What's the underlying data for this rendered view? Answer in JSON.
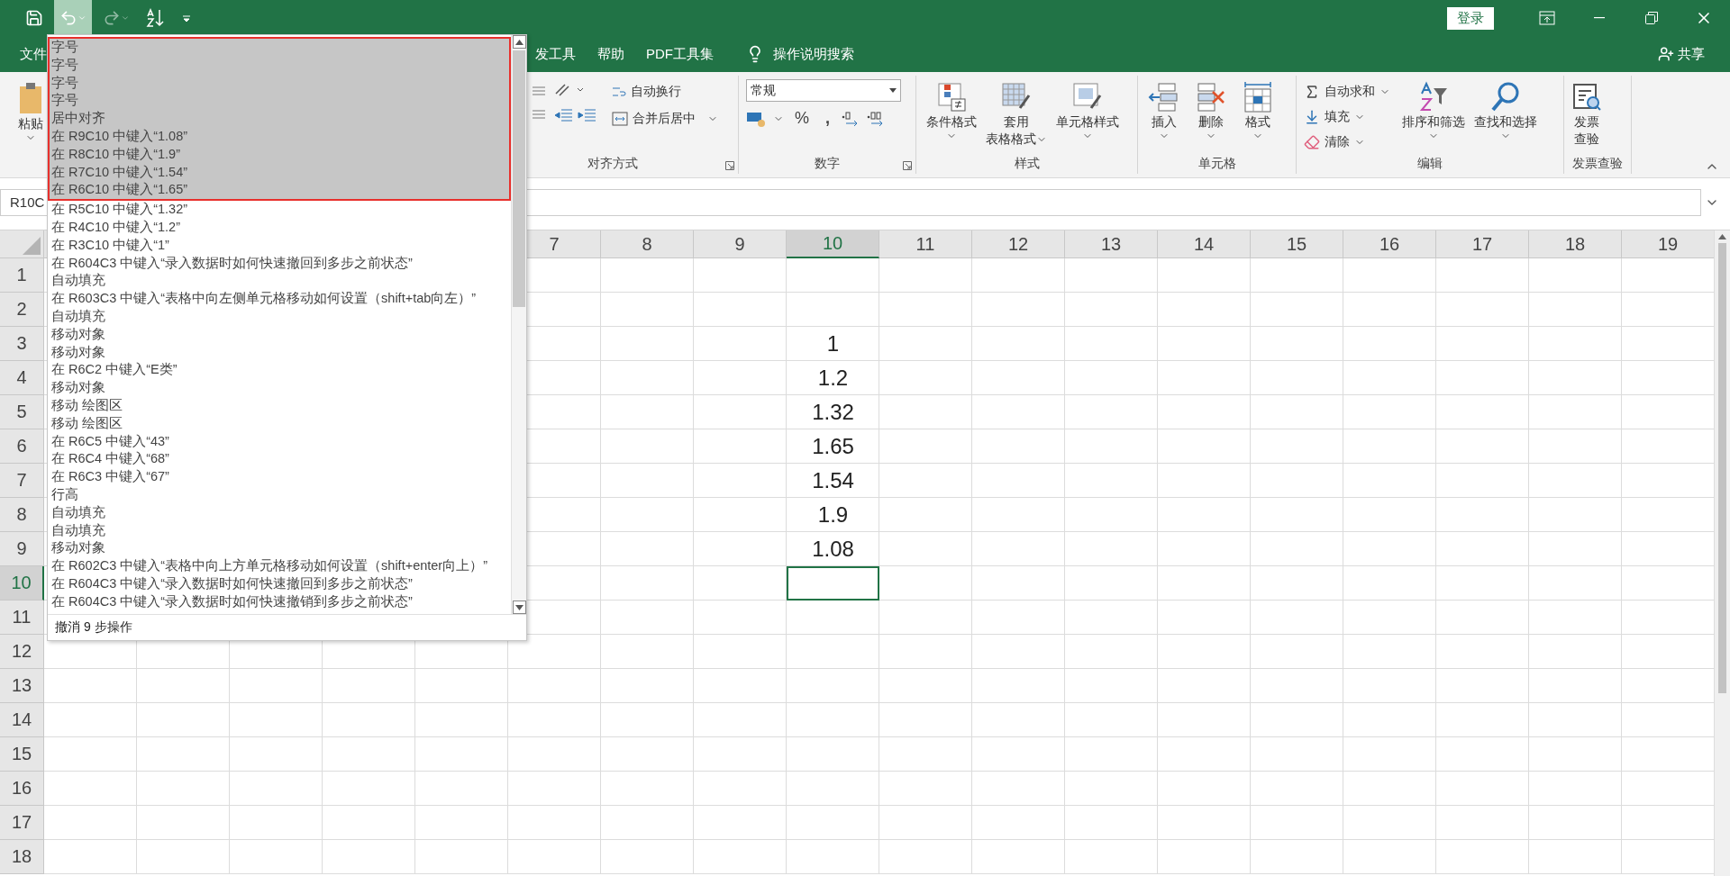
{
  "title_bar": {
    "login_button": "登录"
  },
  "undo_menu": {
    "open": true,
    "footer": "撤消 9 步操作",
    "items": [
      {
        "label": "字号",
        "selected": true
      },
      {
        "label": "字号",
        "selected": true
      },
      {
        "label": "字号",
        "selected": true
      },
      {
        "label": "字号",
        "selected": true
      },
      {
        "label": "居中对齐",
        "selected": true
      },
      {
        "label": "在 R9C10 中键入“1.08”",
        "selected": true
      },
      {
        "label": "在 R8C10 中键入“1.9”",
        "selected": true
      },
      {
        "label": "在 R7C10 中键入“1.54”",
        "selected": true
      },
      {
        "label": "在 R6C10 中键入“1.65”",
        "selected": true
      },
      {
        "label": "在 R5C10 中键入“1.32”",
        "selected": false
      },
      {
        "label": "在 R4C10 中键入“1.2”",
        "selected": false
      },
      {
        "label": "在 R3C10 中键入“1”",
        "selected": false
      },
      {
        "label": "在 R604C3 中键入“录入数据时如何快速撤回到多步之前状态”",
        "selected": false
      },
      {
        "label": "自动填充",
        "selected": false
      },
      {
        "label": "在 R603C3 中键入“表格中向左侧单元格移动如何设置（shift+tab向左）”",
        "selected": false
      },
      {
        "label": "自动填充",
        "selected": false
      },
      {
        "label": "移动对象",
        "selected": false
      },
      {
        "label": "移动对象",
        "selected": false
      },
      {
        "label": "在 R6C2 中键入“E类”",
        "selected": false
      },
      {
        "label": "移动对象",
        "selected": false
      },
      {
        "label": "移动 绘图区",
        "selected": false
      },
      {
        "label": "移动 绘图区",
        "selected": false
      },
      {
        "label": "在 R6C5 中键入“43”",
        "selected": false
      },
      {
        "label": "在 R6C4 中键入“68”",
        "selected": false
      },
      {
        "label": "在 R6C3 中键入“67”",
        "selected": false
      },
      {
        "label": "行高",
        "selected": false
      },
      {
        "label": "自动填充",
        "selected": false
      },
      {
        "label": "自动填充",
        "selected": false
      },
      {
        "label": "移动对象",
        "selected": false
      },
      {
        "label": "在 R602C3 中键入“表格中向上方单元格移动如何设置（shift+enter向上）”",
        "selected": false
      },
      {
        "label": "在 R604C3 中键入“录入数据时如何快速撤回到多步之前状态”",
        "selected": false
      },
      {
        "label": "在 R604C3 中键入“录入数据时如何快速撤销到多步之前状态”",
        "selected": false
      }
    ]
  },
  "menu_tabs": [
    {
      "label": "文件"
    },
    {
      "label": "发工具"
    },
    {
      "label": "帮助"
    },
    {
      "label": "PDF工具集"
    }
  ],
  "tell_me": "操作说明搜索",
  "share": "共享",
  "ribbon": {
    "paste": "粘贴",
    "alignment": {
      "wrap_text": "自动换行",
      "merge_center": "合并后居中",
      "label": "对齐方式"
    },
    "number": {
      "format": "常规",
      "percent": "%",
      "comma": ",",
      "label": "数字"
    },
    "styles": {
      "label": "样式",
      "buttons": [
        {
          "kind": "conditional",
          "lines": [
            "条件格式"
          ],
          "has_menu": true
        },
        {
          "kind": "table",
          "lines": [
            "套用",
            "表格格式"
          ],
          "has_menu": true
        },
        {
          "kind": "cell-style",
          "lines": [
            "单元格样式"
          ],
          "has_menu": true
        }
      ]
    },
    "cells": {
      "label": "单元格",
      "buttons": [
        {
          "kind": "insert",
          "lines": [
            "插入"
          ],
          "has_menu": true
        },
        {
          "kind": "delete",
          "lines": [
            "删除"
          ],
          "has_menu": true
        },
        {
          "kind": "format",
          "lines": [
            "格式"
          ],
          "has_menu": true
        }
      ]
    },
    "editing": {
      "label": "编辑",
      "small": [
        {
          "kind": "autosum",
          "label": "自动求和"
        },
        {
          "kind": "fill",
          "label": "填充"
        },
        {
          "kind": "clear",
          "label": "清除"
        }
      ],
      "buttons": [
        {
          "kind": "sort",
          "lines": [
            "排序和筛选"
          ],
          "has_menu": true
        },
        {
          "kind": "find",
          "lines": [
            "查找和选择"
          ],
          "has_menu": true
        }
      ]
    },
    "invoice": {
      "label": "发票查验",
      "buttons": [
        {
          "kind": "invoice",
          "lines": [
            "发票",
            "查验"
          ],
          "has_menu": false
        }
      ]
    }
  },
  "name_box": "R10C",
  "grid": {
    "columns": [
      {
        "label": "7",
        "selected": false
      },
      {
        "label": "8",
        "selected": false
      },
      {
        "label": "9",
        "selected": false
      },
      {
        "label": "10",
        "selected": true
      },
      {
        "label": "11",
        "selected": false
      },
      {
        "label": "12",
        "selected": false
      },
      {
        "label": "13",
        "selected": false
      },
      {
        "label": "14",
        "selected": false
      },
      {
        "label": "15",
        "selected": false
      },
      {
        "label": "16",
        "selected": false
      },
      {
        "label": "17",
        "selected": false
      },
      {
        "label": "18",
        "selected": false
      },
      {
        "label": "19",
        "selected": false
      }
    ],
    "rows": [
      {
        "label": "1",
        "selected": false
      },
      {
        "label": "2",
        "selected": false
      },
      {
        "label": "3",
        "selected": false,
        "cells": [
          null,
          null,
          null,
          "1"
        ]
      },
      {
        "label": "4",
        "selected": false,
        "cells": [
          null,
          null,
          null,
          "1.2"
        ]
      },
      {
        "label": "5",
        "selected": false,
        "cells": [
          null,
          null,
          null,
          "1.32"
        ]
      },
      {
        "label": "6",
        "selected": false,
        "cells": [
          null,
          null,
          null,
          "1.65"
        ]
      },
      {
        "label": "7",
        "selected": false,
        "cells": [
          null,
          null,
          null,
          "1.54"
        ]
      },
      {
        "label": "8",
        "selected": false,
        "cells": [
          null,
          null,
          null,
          "1.9"
        ]
      },
      {
        "label": "9",
        "selected": false,
        "cells": [
          null,
          null,
          null,
          "1.08"
        ]
      },
      {
        "label": "10",
        "selected": true
      },
      {
        "label": "11",
        "selected": false
      },
      {
        "label": "12",
        "selected": false
      },
      {
        "label": "13",
        "selected": false
      },
      {
        "label": "14",
        "selected": false
      },
      {
        "label": "15",
        "selected": false
      },
      {
        "label": "16",
        "selected": false
      },
      {
        "label": "17",
        "selected": false
      },
      {
        "label": "18",
        "selected": false
      }
    ]
  }
}
